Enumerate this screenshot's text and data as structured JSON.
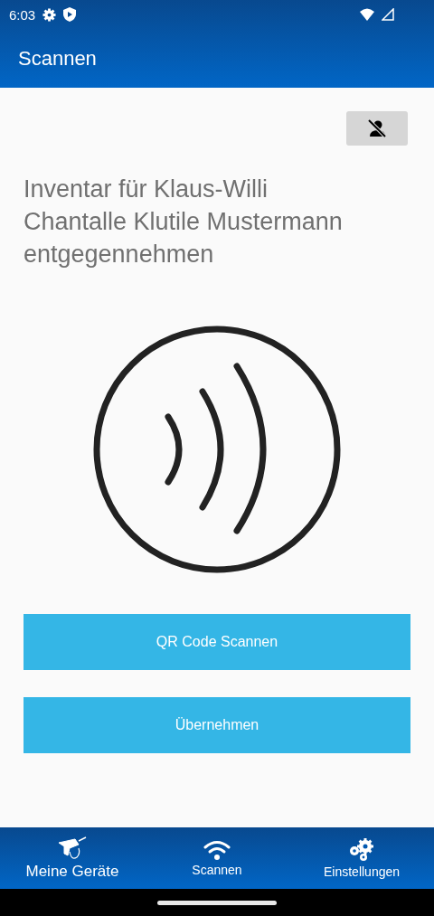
{
  "status_bar": {
    "time": "6:03"
  },
  "app_bar": {
    "title": "Scannen"
  },
  "prompt": "Inventar für Klaus-Willi Chantalle Klutile Mustermann entgegennehmen",
  "buttons": [
    {
      "label": "QR Code Scannen"
    },
    {
      "label": "Übernehmen"
    }
  ],
  "bottom_nav": [
    {
      "label": "Meine Geräte",
      "kind": "drill",
      "selected": true
    },
    {
      "label": "Scannen",
      "kind": "wifi",
      "selected": false
    },
    {
      "label": "Einstellungen",
      "kind": "gears",
      "selected": false
    }
  ]
}
